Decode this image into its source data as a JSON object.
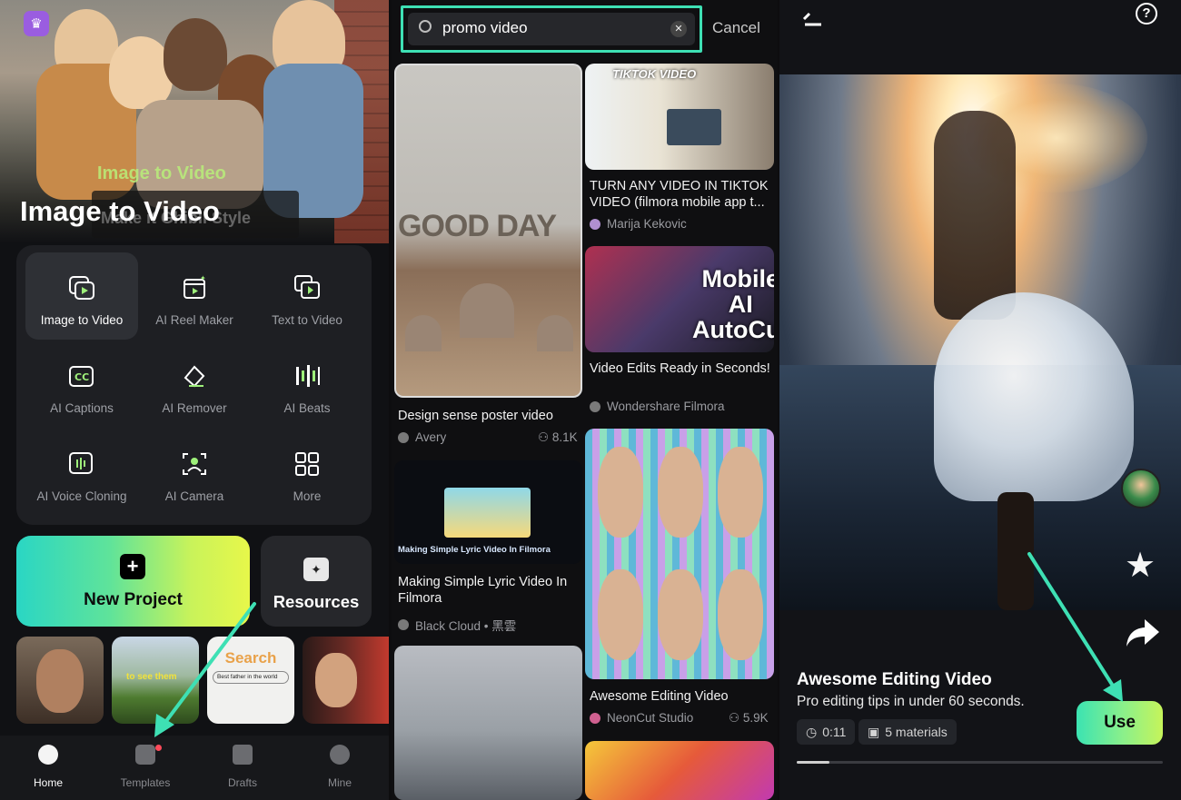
{
  "panel_home": {
    "hero": {
      "title": "Image to Video",
      "subtitle": "Image to Video",
      "overlay_text": "Make it Ghibli Style"
    },
    "tools": [
      {
        "label": "Image to Video",
        "icon": "image-to-video-icon"
      },
      {
        "label": "AI Reel Maker",
        "icon": "reel-maker-icon"
      },
      {
        "label": "Text to Video",
        "icon": "text-to-video-icon"
      },
      {
        "label": "AI Captions",
        "icon": "captions-icon"
      },
      {
        "label": "AI Remover",
        "icon": "eraser-icon"
      },
      {
        "label": "AI Beats",
        "icon": "beats-icon"
      },
      {
        "label": "AI Voice Cloning",
        "icon": "voice-clone-icon"
      },
      {
        "label": "AI Camera",
        "icon": "camera-icon"
      },
      {
        "label": "More",
        "icon": "grid-icon"
      }
    ],
    "new_project": "New Project",
    "resources": "Resources",
    "thumb_texts": [
      "to see them",
      "Search",
      "Best father in the world"
    ],
    "nav": [
      {
        "label": "Home",
        "icon": "home-icon",
        "active": true
      },
      {
        "label": "Templates",
        "icon": "templates-icon",
        "active": false
      },
      {
        "label": "Drafts",
        "icon": "drafts-icon",
        "active": false
      },
      {
        "label": "Mine",
        "icon": "user-icon",
        "active": false
      }
    ]
  },
  "panel_search": {
    "query": "promo video",
    "cancel": "Cancel",
    "results": [
      {
        "title": "Design sense poster video",
        "author": "Avery",
        "uses": "8.1K",
        "overlay": "GOOD DAY"
      },
      {
        "title": "Making Simple Lyric Video In Filmora",
        "author": "Black Cloud • 黑雲",
        "uses": "",
        "overlay": "Making Simple Lyric Video In Filmora"
      },
      {
        "title": "TURN ANY VIDEO IN TIKTOK VIDEO (filmora mobile app t...",
        "author": "Marija Kekovic",
        "uses": "",
        "overlay": "TIKTOK VIDEO"
      },
      {
        "title": "Video Edits Ready in Seconds!",
        "author": "Wondershare Filmora",
        "uses": "",
        "overlay": "Mobile AI AutoCut"
      },
      {
        "title": "Awesome Editing Video",
        "author": "NeonCut Studio",
        "uses": "5.9K",
        "overlay": ""
      }
    ]
  },
  "panel_detail": {
    "title": "Awesome Editing Video",
    "description": "Pro editing tips in under 60 seconds.",
    "duration": "0:11",
    "materials": "5 materials",
    "use_button": "Use",
    "help": "?",
    "progress": 0.09
  },
  "colors": {
    "accent": "#3ee0b4",
    "brand_gradient_start": "#2ad6c4",
    "brand_gradient_end": "#e7f74a"
  }
}
